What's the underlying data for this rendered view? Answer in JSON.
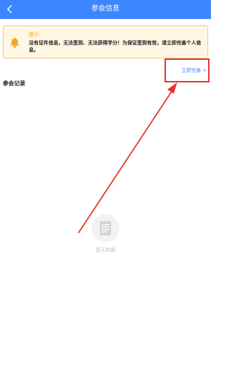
{
  "header": {
    "title": "参会信息",
    "back_icon": "chevron-left-icon",
    "background": "#3d86ff"
  },
  "notice": {
    "icon": "bell-icon",
    "label": "提示:",
    "message": "没有证件信息，无法签到、无法获得学分！为保证签到有效，请立即完善个人信息。",
    "background": "#fff6e3",
    "border": "#f6c986",
    "accent": "#f5a623"
  },
  "complete_link": {
    "label": "立即完善 >",
    "color": "#3d86ff"
  },
  "records": {
    "title": "参会记录",
    "empty_icon": "document-icon",
    "empty_text": "暂无数据"
  },
  "annotation": {
    "color": "#e8312e"
  }
}
